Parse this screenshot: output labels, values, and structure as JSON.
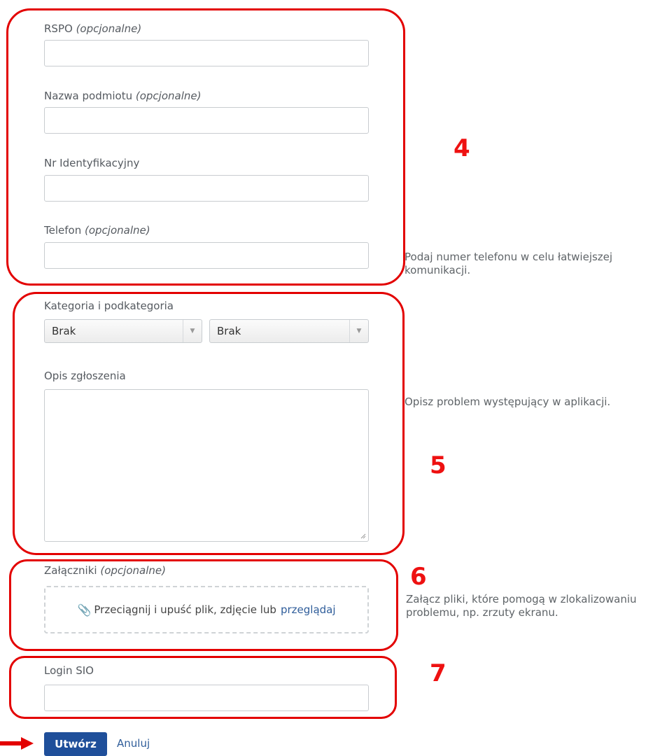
{
  "fields": {
    "rspo": {
      "label": "RSPO",
      "optional": "(opcjonalne)",
      "value": ""
    },
    "entity_name": {
      "label": "Nazwa podmiotu",
      "optional": "(opcjonalne)",
      "value": ""
    },
    "id_number": {
      "label": "Nr Identyfikacyjny",
      "value": ""
    },
    "phone": {
      "label": "Telefon",
      "optional": "(opcjonalne)",
      "value": "",
      "help_line1": "Podaj numer telefonu w celu łatwiejszej",
      "help_line2": "komunikacji."
    },
    "category": {
      "label": "Kategoria i podkategoria",
      "category_value": "Brak",
      "subcategory_value": "Brak"
    },
    "description": {
      "label": "Opis zgłoszenia",
      "value": "",
      "help": "Opisz problem występujący w aplikacji."
    },
    "attachments": {
      "label": "Załączniki",
      "optional": "(opcjonalne)",
      "drop_text": "Przeciągnij i upuść plik, zdjęcie lub",
      "browse_link": "przeglądaj",
      "help_line1": "Załącz pliki, które pomogą w zlokalizowaniu",
      "help_line2": "problemu, np. zrzuty ekranu."
    },
    "login": {
      "label": "Login SIO",
      "value": ""
    }
  },
  "actions": {
    "create": "Utwórz",
    "cancel": "Anuluj"
  },
  "annotations": {
    "n4": "4",
    "n5": "5",
    "n6": "6",
    "n7": "7"
  },
  "colors": {
    "annotation": "#e30000",
    "primary": "#1f4f9a",
    "link": "#2f5d9a"
  },
  "icons": {
    "attachment": "paperclip-icon",
    "select_arrow": "triangle-down-icon",
    "pointer": "red-arrow-icon"
  }
}
